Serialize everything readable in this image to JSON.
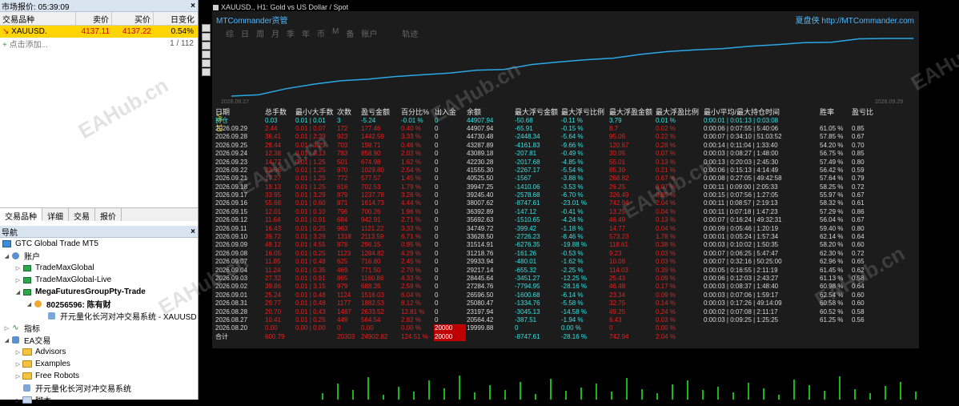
{
  "market_watch": {
    "title": "市场报价: 05:39:09",
    "headers": {
      "symbol": "交易品种",
      "bid": "卖价",
      "ask": "买价",
      "change": "日变化"
    },
    "rows": [
      {
        "symbol": "XAUUSD.",
        "bid": "4137.11",
        "ask": "4137.22",
        "change": "0.54%"
      }
    ],
    "add_label": "点击添加...",
    "count": "1 / 112",
    "tabs": [
      "交易品种",
      "详细",
      "交易",
      "报价"
    ]
  },
  "navigator": {
    "title": "导航",
    "broker": "GTC Global Trade MT5",
    "accounts_label": "账户",
    "servers": [
      "TradeMaxGlobal",
      "TradeMaxGlobal-Live",
      "MegaFuturesGroupPty-Trade"
    ],
    "account": "80256596: 陈有财",
    "account_ea": "开元量化长河对冲交易系统 - XAUUSD",
    "indicators": "指标",
    "ea": "EA交易",
    "ea_folders": [
      "Advisors",
      "Examples",
      "Free Robots"
    ],
    "ea_item": "开元量化长河对冲交易系统",
    "scripts": "脚本"
  },
  "chart": {
    "title": "XAUUSD., H1: Gold vs US Dollar / Spot",
    "brand": "MTCommander资管",
    "site": "夏盘侠 http://MTCommander.com",
    "tabs": [
      "综",
      "日",
      "周",
      "月",
      "季",
      "年",
      "币",
      "M",
      "备",
      "账户"
    ],
    "extra_tab": "轨迹",
    "date_start": "2026.08.27",
    "date_end": "2026.09.29",
    "version": "V8.18",
    "watermark": "EAHub.cn",
    "curve_balance": [
      19999.88,
      20564.42,
      23197.94,
      25080.47,
      26596.5,
      27284.76,
      28445.64,
      29217.14,
      29933.94,
      31218.76,
      31514.91,
      33628.5,
      34749.72,
      35692.63,
      36392.89,
      38007.62,
      39245.4,
      39947.25,
      40525.5,
      41555.3,
      42230.28,
      43089.18,
      43287.89,
      44730.48,
      44907.94,
      44907.94
    ]
  },
  "stats": {
    "headers": [
      "日期",
      "总手数",
      "最小/大手数",
      "次数",
      "盈亏金额",
      "百分比%",
      "出入金",
      "余额",
      "最大浮亏金额",
      "最大浮亏比例",
      "最大浮盈金额",
      "最大浮盈比例",
      "最小/平均/最大持仓时间",
      "胜率",
      "盈亏比"
    ],
    "open": [
      "持仓",
      "0.03",
      "0.01 | 0.01",
      "3",
      "-5.24",
      "-0.01 %",
      "0",
      "44907.94",
      "-50.68",
      "-0.11 %",
      "3.79",
      "0.01 %",
      "0:00:01 | 0:01:13 | 0:03:08",
      "",
      ""
    ],
    "rows": [
      [
        "2026.09.29",
        "2.44",
        "0.01 | 0.07",
        "172",
        "177.46",
        "0.40 %",
        "0",
        "44907.94",
        "-65.91",
        "-0.15 %",
        "8.7",
        "0.02 %",
        "0:00:06 | 0:07:55 | 5:40:06",
        "61.05 %",
        "0.85"
      ],
      [
        "2026.09.28",
        "36.41",
        "0.01 | 2.39",
        "923",
        "1442.59",
        "3.33 %",
        "0",
        "44730.48",
        "-2448.34",
        "-5.64 %",
        "95.06",
        "0.22 %",
        "0:00:07 | 0:34:10 | 51:03:52",
        "57.85 %",
        "0.67"
      ],
      [
        "2026.09.25",
        "28.44",
        "0.01 | 3.29",
        "703",
        "198.71",
        "0.46 %",
        "0",
        "43287.89",
        "-4161.83",
        "-9.66 %",
        "120.67",
        "0.28 %",
        "0:00:14 | 0:11:04 | 1:33:40",
        "54.20 %",
        "0.70"
      ],
      [
        "2026.09.24",
        "12.38",
        "0.01 | 0.13",
        "783",
        "858.90",
        "2.03 %",
        "0",
        "43089.18",
        "-207.81",
        "-0.49 %",
        "30.05",
        "0.07 %",
        "0:00:03 | 0:08:27 | 1:48:00",
        "56.75 %",
        "0.85"
      ],
      [
        "2026.09.23",
        "14.77",
        "0.01 | 1.25",
        "501",
        "674.98",
        "1.62 %",
        "0",
        "42230.28",
        "-2017.68",
        "-4.85 %",
        "55.01",
        "0.13 %",
        "0:00:13 | 0:20:03 | 2:45:30",
        "57.49 %",
        "0.80"
      ],
      [
        "2026.09.22",
        "23.96",
        "0.01 | 1.25",
        "970",
        "1029.80",
        "2.54 %",
        "0",
        "41555.30",
        "-2267.17",
        "-5.54 %",
        "85.39",
        "0.21 %",
        "0:00:06 | 0:15:13 | 4:14:49",
        "56.42 %",
        "0.59"
      ],
      [
        "2026.09.21",
        "17.27",
        "0.01 | 1.25",
        "772",
        "577.57",
        "1.45 %",
        "0",
        "40525.50",
        "-1567",
        "-3.88 %",
        "268.82",
        "0.67 %",
        "0:00:08 | 0:27:05 | 49:42:58",
        "57.64 %",
        "0.79"
      ],
      [
        "2026.09.18",
        "19.13",
        "0.01 | 1.25",
        "616",
        "702.53",
        "1.79 %",
        "0",
        "39947.25",
        "-1410.06",
        "-3.53 %",
        "26.25",
        "0.07 %",
        "0:00:11 | 0:09:00 | 2:05:33",
        "58.25 %",
        "0.72"
      ],
      [
        "2026.09.17",
        "33.95",
        "0.01 | 3.29",
        "879",
        "1237.78",
        "3.26 %",
        "0",
        "39245.40",
        "-2578.68",
        "-6.70 %",
        "326.49",
        "0.85 %",
        "0:00:15 | 0:07:56 | 1:27:05",
        "55.97 %",
        "0.67"
      ],
      [
        "2026.09.16",
        "55.68",
        "0.01 | 0.60",
        "871",
        "1614.73",
        "4.44 %",
        "0",
        "38007.62",
        "-8747.61",
        "-23.01 %",
        "742.94",
        "2.04 %",
        "0:00:11 | 0:08:57 | 2:19:13",
        "58.32 %",
        "0.61"
      ],
      [
        "2026.09.15",
        "12.01",
        "0.01 | 0.10",
        "796",
        "700.26",
        "1.96 %",
        "0",
        "36392.89",
        "-147.12",
        "-0.41 %",
        "13.25",
        "0.04 %",
        "0:00:11 | 0:07:18 | 1:47:23",
        "57.29 %",
        "0.86"
      ],
      [
        "2026.09.12",
        "11.64",
        "0.01 | 0.91",
        "684",
        "942.91",
        "2.71 %",
        "0",
        "35692.63",
        "-1510.65",
        "-4.24 %",
        "46.49",
        "0.13 %",
        "0:00:07 | 0:16:24 | 49:32:31",
        "56.04 %",
        "0.67"
      ],
      [
        "2026.09.11",
        "16.43",
        "0.01 | 0.25",
        "963",
        "1121.22",
        "3.33 %",
        "0",
        "34749.72",
        "-399.42",
        "-1.18 %",
        "14.77",
        "0.04 %",
        "0:00:09 | 0:05:46 | 1:20:19",
        "59.40 %",
        "0.80"
      ],
      [
        "2026.09.10",
        "39.72",
        "0.01 | 3.29",
        "1318",
        "2113.59",
        "6.71 %",
        "0",
        "33628.50",
        "-2726.23",
        "-8.46 %",
        "573.23",
        "1.78 %",
        "0:00:01 | 0:05:24 | 1:57:34",
        "62.14 %",
        "0.64"
      ],
      [
        "2026.09.09",
        "49.12",
        "0.01 | 4.55",
        "878",
        "296.15",
        "0.95 %",
        "0",
        "31514.91",
        "-6276.35",
        "-19.88 %",
        "118.61",
        "0.38 %",
        "0:00:03 | 0:10:02 | 1:50:35",
        "58.20 %",
        "0.60"
      ],
      [
        "2026.09.08",
        "16.05",
        "0.01 | 0.25",
        "1123",
        "1284.82",
        "4.29 %",
        "0",
        "31218.76",
        "-161.26",
        "-0.53 %",
        "9.23",
        "0.03 %",
        "0:00:07 | 0:06:25 | 5:47:47",
        "62.30 %",
        "0.72"
      ],
      [
        "2026.09.07",
        "11.85",
        "0.01 | 0.48",
        "625",
        "716.80",
        "2.45 %",
        "0",
        "29933.94",
        "-480.01",
        "-1.62 %",
        "10.08",
        "0.03 %",
        "0:00:07 | 0:32:16 | 50:25:00",
        "62.96 %",
        "0.65"
      ],
      [
        "2026.09.04",
        "11.24",
        "0.01 | 0.35",
        "469",
        "771.50",
        "2.70 %",
        "0",
        "29217.14",
        "-655.32",
        "-2.25 %",
        "114.03",
        "0.39 %",
        "0:00:05 | 0:16:55 | 2:11:19",
        "61.45 %",
        "0.62"
      ],
      [
        "2026.09.03",
        "27.32",
        "0.01 | 0.91",
        "865",
        "1160.88",
        "4.33 %",
        "0",
        "28445.64",
        "-3451.27",
        "-12.25 %",
        "25.43",
        "0.09 %",
        "0:00:06 | 0:12:03 | 2:43:27",
        "61.13 %",
        "0.58"
      ],
      [
        "2026.09.02",
        "39.86",
        "0.01 | 3.15",
        "979",
        "688.26",
        "2.59 %",
        "0",
        "27284.76",
        "-7794.95",
        "-28.16 %",
        "46.48",
        "0.17 %",
        "0:00:03 | 0:08:37 | 1:48:40",
        "60.98 %",
        "0.64"
      ],
      [
        "2026.09.01",
        "25.24",
        "0.01 | 0.48",
        "1124",
        "1516.03",
        "6.04 %",
        "0",
        "26596.50",
        "-1600.68",
        "-6.14 %",
        "23.34",
        "0.09 %",
        "0:00:03 | 0:07:06 | 1:59:17",
        "62.54 %",
        "0.60"
      ],
      [
        "2026.08.31",
        "29.77",
        "0.01 | 0.48",
        "1177",
        "1882.53",
        "8.12 %",
        "0",
        "25080.47",
        "-1334.76",
        "-5.58 %",
        "32.75",
        "0.14 %",
        "0:00:03 | 0:17:26 | 49:14:09",
        "60.58 %",
        "0.60"
      ],
      [
        "2026.08.28",
        "20.70",
        "0.01 | 0.43",
        "1487",
        "2633.52",
        "12.81 %",
        "0",
        "23197.94",
        "-3045.13",
        "-14.58 %",
        "49.25",
        "0.24 %",
        "0:00:02 | 0:07:08 | 2:11:17",
        "60.52 %",
        "0.58"
      ],
      [
        "2026.08.27",
        "10.41",
        "0.01 | 0.25",
        "449",
        "564.54",
        "2.82 %",
        "0",
        "20564.42",
        "-387.51",
        "-1.94 %",
        "6.43",
        "0.03 %",
        "0:00:03 | 0:09:25 | 1:25:25",
        "61.25 %",
        "0.56"
      ],
      [
        "2026.08.20",
        "0.00",
        "0.00 | 0.00",
        "0",
        "0.00",
        "0.00 %",
        "20000",
        "19999.88",
        "0",
        "0.00 %",
        "0",
        "0.00 %",
        "",
        "",
        ""
      ]
    ],
    "total": [
      "合计",
      "600.79",
      "",
      "20303",
      "24902.82",
      "124.51 %",
      "20000",
      "",
      "-8747.61",
      "-28.16 %",
      "742.94",
      "2.04 %",
      "",
      "",
      ""
    ]
  }
}
